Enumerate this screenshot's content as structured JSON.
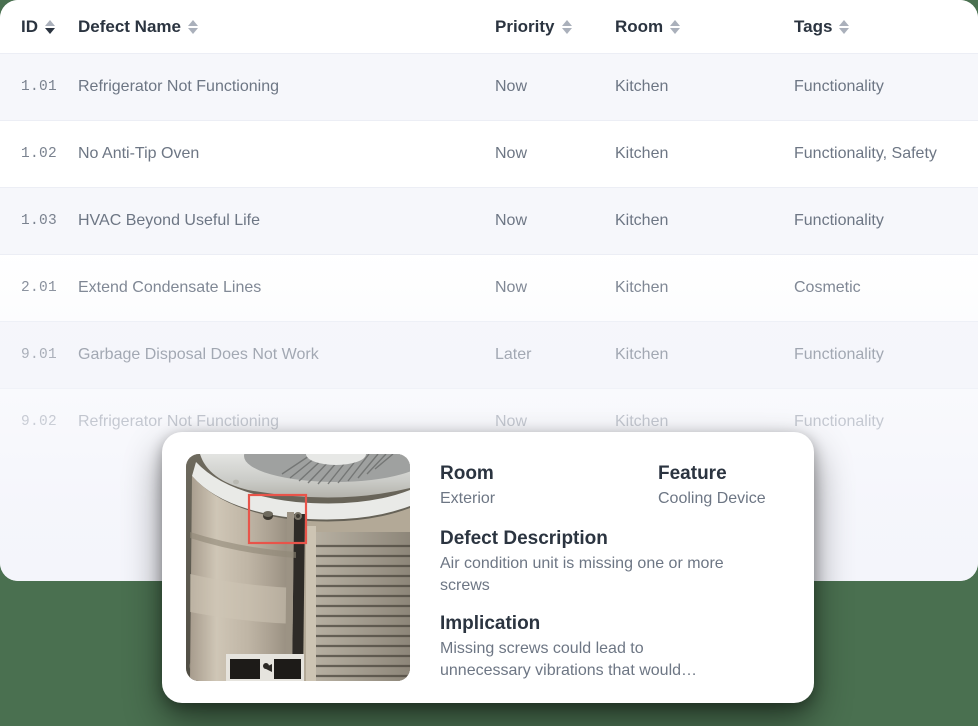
{
  "theme": {
    "page_background": "#4a7050",
    "panel_background": "#ffffff",
    "row_alt_background": "#f6f7fb",
    "heading_color": "#2b3440",
    "body_text_color": "#6d7684",
    "annotation_box_color": "#e8544a"
  },
  "table": {
    "columns": [
      {
        "key": "id",
        "label": "ID",
        "sort_icon": "sort-icon",
        "sort_active": true
      },
      {
        "key": "name",
        "label": "Defect Name",
        "sort_icon": "sort-icon",
        "sort_active": false
      },
      {
        "key": "priority",
        "label": "Priority",
        "sort_icon": "sort-icon",
        "sort_active": false
      },
      {
        "key": "room",
        "label": "Room",
        "sort_icon": "sort-icon",
        "sort_active": false
      },
      {
        "key": "tags",
        "label": "Tags",
        "sort_icon": "sort-icon",
        "sort_active": false
      }
    ],
    "rows": [
      {
        "id": "1.01",
        "name": "Refrigerator Not Functioning",
        "priority": "Now",
        "room": "Kitchen",
        "tags": "Functionality"
      },
      {
        "id": "1.02",
        "name": "No Anti-Tip Oven",
        "priority": "Now",
        "room": "Kitchen",
        "tags": "Functionality, Safety"
      },
      {
        "id": "1.03",
        "name": "HVAC Beyond Useful Life",
        "priority": "Now",
        "room": "Kitchen",
        "tags": "Functionality"
      },
      {
        "id": "2.01",
        "name": "Extend Condensate Lines",
        "priority": "Now",
        "room": "Kitchen",
        "tags": "Cosmetic"
      },
      {
        "id": "9.01",
        "name": "Garbage Disposal Does Not Work",
        "priority": "Later",
        "room": "Kitchen",
        "tags": "Functionality"
      },
      {
        "id": "9.02",
        "name": "Refrigerator Not Functioning",
        "priority": "Now",
        "room": "Kitchen",
        "tags": "Functionality"
      }
    ]
  },
  "detail_card": {
    "photo": {
      "name": "defect-photo",
      "subject": "air-conditioning-condenser-unit",
      "annotation": "red-rectangle-highlight"
    },
    "room": {
      "label": "Room",
      "value": "Exterior"
    },
    "feature": {
      "label": "Feature",
      "value": "Cooling Device"
    },
    "defect_description": {
      "label": "Defect Description",
      "value": "Air condition unit is missing one or more screws"
    },
    "implication": {
      "label": "Implication",
      "value": "Missing screws could lead to unnecessary vibrations that would…"
    }
  }
}
